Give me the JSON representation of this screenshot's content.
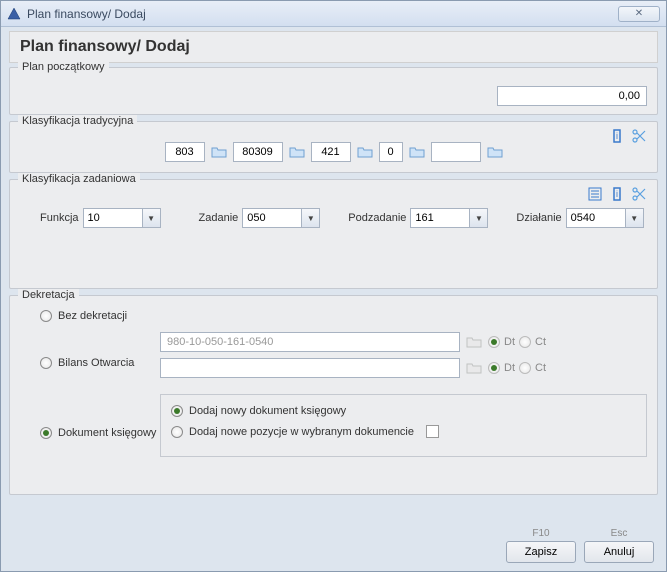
{
  "window": {
    "title": "Plan finansowy/ Dodaj"
  },
  "header": {
    "title": "Plan finansowy/ Dodaj"
  },
  "plan_poczatkowy": {
    "label": "Plan początkowy",
    "amount": "0,00"
  },
  "klasyfikacja_tradycyjna": {
    "label": "Klasyfikacja tradycyjna",
    "fields": {
      "f1": "803",
      "f2": "80309",
      "f3": "421",
      "f4": "0",
      "f5": ""
    }
  },
  "klasyfikacja_zadaniowa": {
    "label": "Klasyfikacja zadaniowa",
    "funkcja": {
      "label": "Funkcja",
      "value": "10"
    },
    "zadanie": {
      "label": "Zadanie",
      "value": "050"
    },
    "podzadanie": {
      "label": "Podzadanie",
      "value": "161"
    },
    "dzialanie": {
      "label": "Działanie",
      "value": "0540"
    }
  },
  "dekretacja": {
    "label": "Dekretacja",
    "bez_dekretacji": "Bez dekretacji",
    "bilans_otwarcia": {
      "label": "Bilans Otwarcia",
      "line1": "980-10-050-161-0540",
      "line2": "",
      "dt": "Dt",
      "ct": "Ct"
    },
    "dokument_ksiegowy": {
      "label": "Dokument księgowy",
      "opt1": "Dodaj nowy dokument księgowy",
      "opt2": "Dodaj nowe pozycje w wybranym dokumencie"
    }
  },
  "footer": {
    "save": {
      "shortcut": "F10",
      "label": "Zapisz"
    },
    "cancel": {
      "shortcut": "Esc",
      "label": "Anuluj"
    }
  }
}
